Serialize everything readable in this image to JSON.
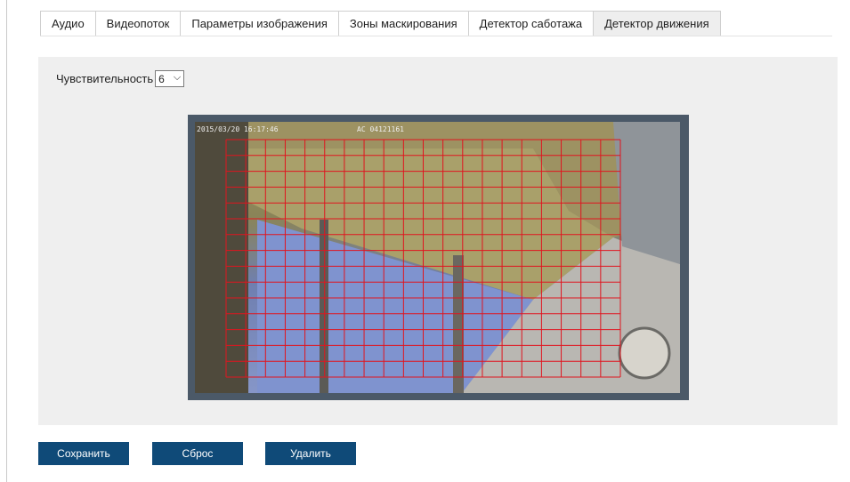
{
  "tabs": [
    {
      "label": "Аудио",
      "active": false
    },
    {
      "label": "Видеопоток",
      "active": false
    },
    {
      "label": "Параметры изображения",
      "active": false
    },
    {
      "label": "Зоны маскирования",
      "active": false
    },
    {
      "label": "Детектор саботажа",
      "active": false
    },
    {
      "label": "Детектор движения",
      "active": true
    }
  ],
  "sensitivity": {
    "label": "Чувствительность",
    "value": "6"
  },
  "video": {
    "timestamp": "2015/03/20 16:17:46",
    "camera_id": "AC 04121161"
  },
  "buttons": {
    "save": "Сохранить",
    "reset": "Сброс",
    "delete": "Удалить"
  },
  "colors": {
    "button_bg": "#0f4a78",
    "grid_line": "#e0151f",
    "active_tab": "#eeeeee"
  }
}
